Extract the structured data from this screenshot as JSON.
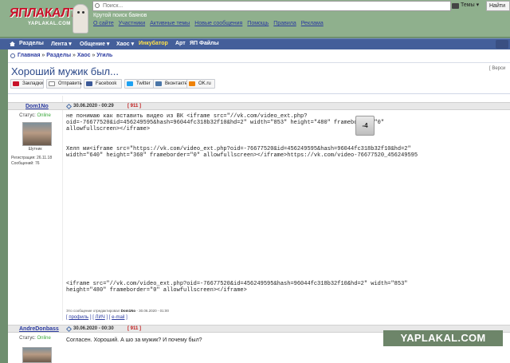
{
  "header": {
    "logo_text": "ЯПЛАКАЛЪ",
    "logo_sub": "YAPLAKAL.COM",
    "tagline": "Крутой поиск баянов",
    "links": [
      "О сайте",
      "Участники",
      "Активные темы",
      "Новые сообщения",
      "Помощь",
      "Правила",
      "Реклама"
    ]
  },
  "search": {
    "placeholder": "Поиск...",
    "scope": "Темы ▾",
    "button": "Найти"
  },
  "nav": {
    "items": [
      "Разделы",
      "Лента ▾",
      "Общение ▾",
      "Хаос ▾",
      "Инкубатор",
      "Арт",
      "ЯП Файлы"
    ]
  },
  "breadcrumb": [
    "Главная",
    "Разделы",
    "Хаос",
    "Угиль"
  ],
  "page": {
    "title": "Хороший мужик был...",
    "version_link": "[ Верси"
  },
  "share": {
    "buttons": [
      "Закладки",
      "Отправить",
      "Facebook",
      "Twitter",
      "Вконтакте",
      "OK.ru"
    ]
  },
  "posts": [
    {
      "author": "Dom1No",
      "date": "30.06.2020 - 00:29",
      "number": "[ 911 ]",
      "status_label": "Статус:",
      "status_value": "Online",
      "rank": "Шутник",
      "registered": "Регистрация: 26.11.18",
      "messages": "Сообщений: 76",
      "rating": "-4",
      "body_lines": [
        "не понимаю как вставить видео из ВК <iframe src=\"//vk.com/video_ext.php?",
        "oid=-76677520&id=456249595&hash=96044fc318b32f10&hd=2\" width=\"853\" height=\"480\" frameborder=\"0\"",
        "allowfullscreen></iframe>",
        "",
        "",
        "Хелп ми<iframe src=\"https://vk.com/video_ext.php?oid=-76677520&id=456249595&hash=96044fc318b32f10&hd=2\"",
        "width=\"640\" height=\"360\" frameborder=\"0\" allowfullscreen></iframe>https://vk.com/video-76677520_456249595"
      ],
      "tail_lines": [
        "<iframe src=\"//vk.com/video_ext.php?oid=-76677520&id=456249595&hash=96044fc318b32f10&hd=2\" width=\"853\"",
        "height=\"480\" frameborder=\"0\" allowfullscreen></iframe>"
      ],
      "edit_note_prefix": "Это сообщение отредактировал",
      "edit_note_author": "Dom1No",
      "edit_note_date": "- 30.06.2020 - 01:00",
      "actions": [
        "профиль",
        "ЛИЧ",
        "e-mail"
      ]
    },
    {
      "author": "AndreDonbass",
      "date": "30.06.2020 - 00:30",
      "number": "[ 911 ]",
      "status_label": "Статус:",
      "status_value": "Online",
      "body": "Согласен. Хороший. А шо за мужик? И почему был?"
    }
  ],
  "watermark": "YAPLAKAL.COM",
  "colors": {
    "header_bg": "#8fb08d",
    "nav_bg": "#445f9a",
    "link": "#2a3aa0",
    "title": "#2d4a8a",
    "online": "#3aa83a",
    "post_number": "#c01818"
  }
}
